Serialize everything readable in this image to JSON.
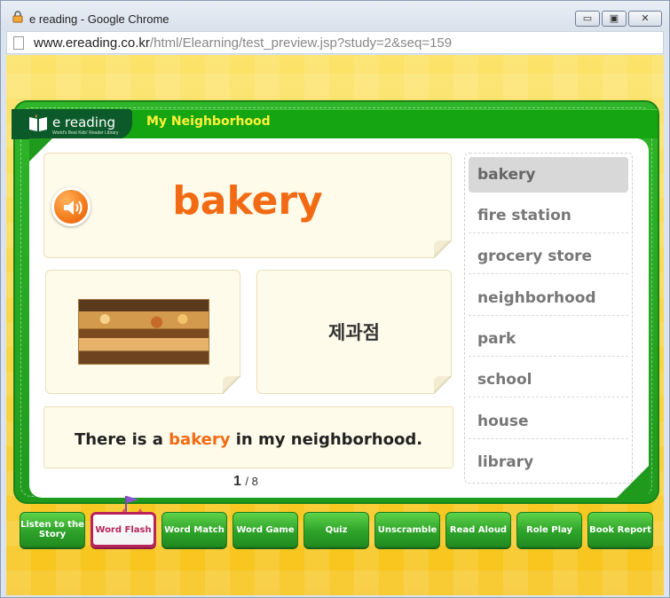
{
  "window": {
    "title": "e reading - Google Chrome",
    "url_host": "www.ereading.co.kr",
    "url_path": "/html/Elearning/test_preview.jsp?study=2&seq=159",
    "minimize": "▭",
    "restore": "▣",
    "close": "✕"
  },
  "app": {
    "logo_text": "e reading",
    "logo_sub": "World's Best Kids' Reader Library",
    "lesson_title": "My Neighborhood"
  },
  "flashcard": {
    "word": "bakery",
    "meaning": "제과점",
    "sentence_before": "There is a ",
    "sentence_highlight": "bakery",
    "sentence_after": " in my neighborhood.",
    "page_current": "1",
    "page_total": "/ 8"
  },
  "word_list": [
    {
      "label": "bakery",
      "active": true
    },
    {
      "label": "fire station",
      "active": false
    },
    {
      "label": "grocery store",
      "active": false
    },
    {
      "label": "neighborhood",
      "active": false
    },
    {
      "label": "park",
      "active": false
    },
    {
      "label": "school",
      "active": false
    },
    {
      "label": "house",
      "active": false
    },
    {
      "label": "library",
      "active": false
    }
  ],
  "nav": [
    {
      "label": "Listen to the Story",
      "active": false
    },
    {
      "label": "Word Flash",
      "active": true
    },
    {
      "label": "Word Match",
      "active": false
    },
    {
      "label": "Word Game",
      "active": false
    },
    {
      "label": "Quiz",
      "active": false
    },
    {
      "label": "Unscramble",
      "active": false
    },
    {
      "label": "Read Aloud",
      "active": false
    },
    {
      "label": "Role Play",
      "active": false
    },
    {
      "label": "Book Report",
      "active": false
    }
  ],
  "colors": {
    "accent_orange": "#f26b14",
    "board_green": "#1f9a1d",
    "title_yellow": "#fff23a",
    "active_nav": "#b8245a"
  }
}
